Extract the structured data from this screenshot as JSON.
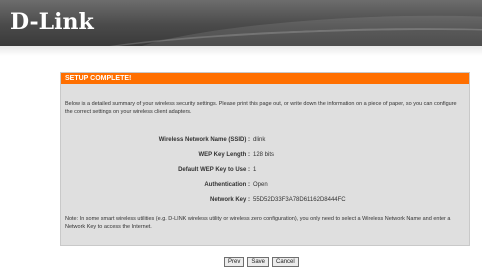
{
  "brand": {
    "logo_text": "D-Link"
  },
  "panel": {
    "title": "SETUP COMPLETE!",
    "intro": "Below is a detailed summary of your wireless security settings. Please print this page out, or write down the information on a piece of paper, so you can configure the correct settings on your wireless client adapters.",
    "fields": [
      {
        "label": "Wireless Network Name (SSID) :",
        "value": "dlink"
      },
      {
        "label": "WEP Key Length :",
        "value": "128 bits"
      },
      {
        "label": "Default WEP Key to Use :",
        "value": "1"
      },
      {
        "label": "Authentication :",
        "value": "Open"
      },
      {
        "label": "Network Key :",
        "value": "55D52D33F3A78D61162D8444FC"
      }
    ],
    "note": "Note: In some smart wireless utilities (e.g. D-LINK wireless utility or wireless zero configuration), you only need to select a Wireless Network Name and enter a Network Key to access the Internet.",
    "buttons": {
      "prev": "Prev",
      "save": "Save",
      "cancel": "Cancel"
    }
  },
  "colors": {
    "accent": "#ff6f00",
    "header_bg": "#4a4a4a",
    "panel_bg": "#dfdfdf"
  }
}
